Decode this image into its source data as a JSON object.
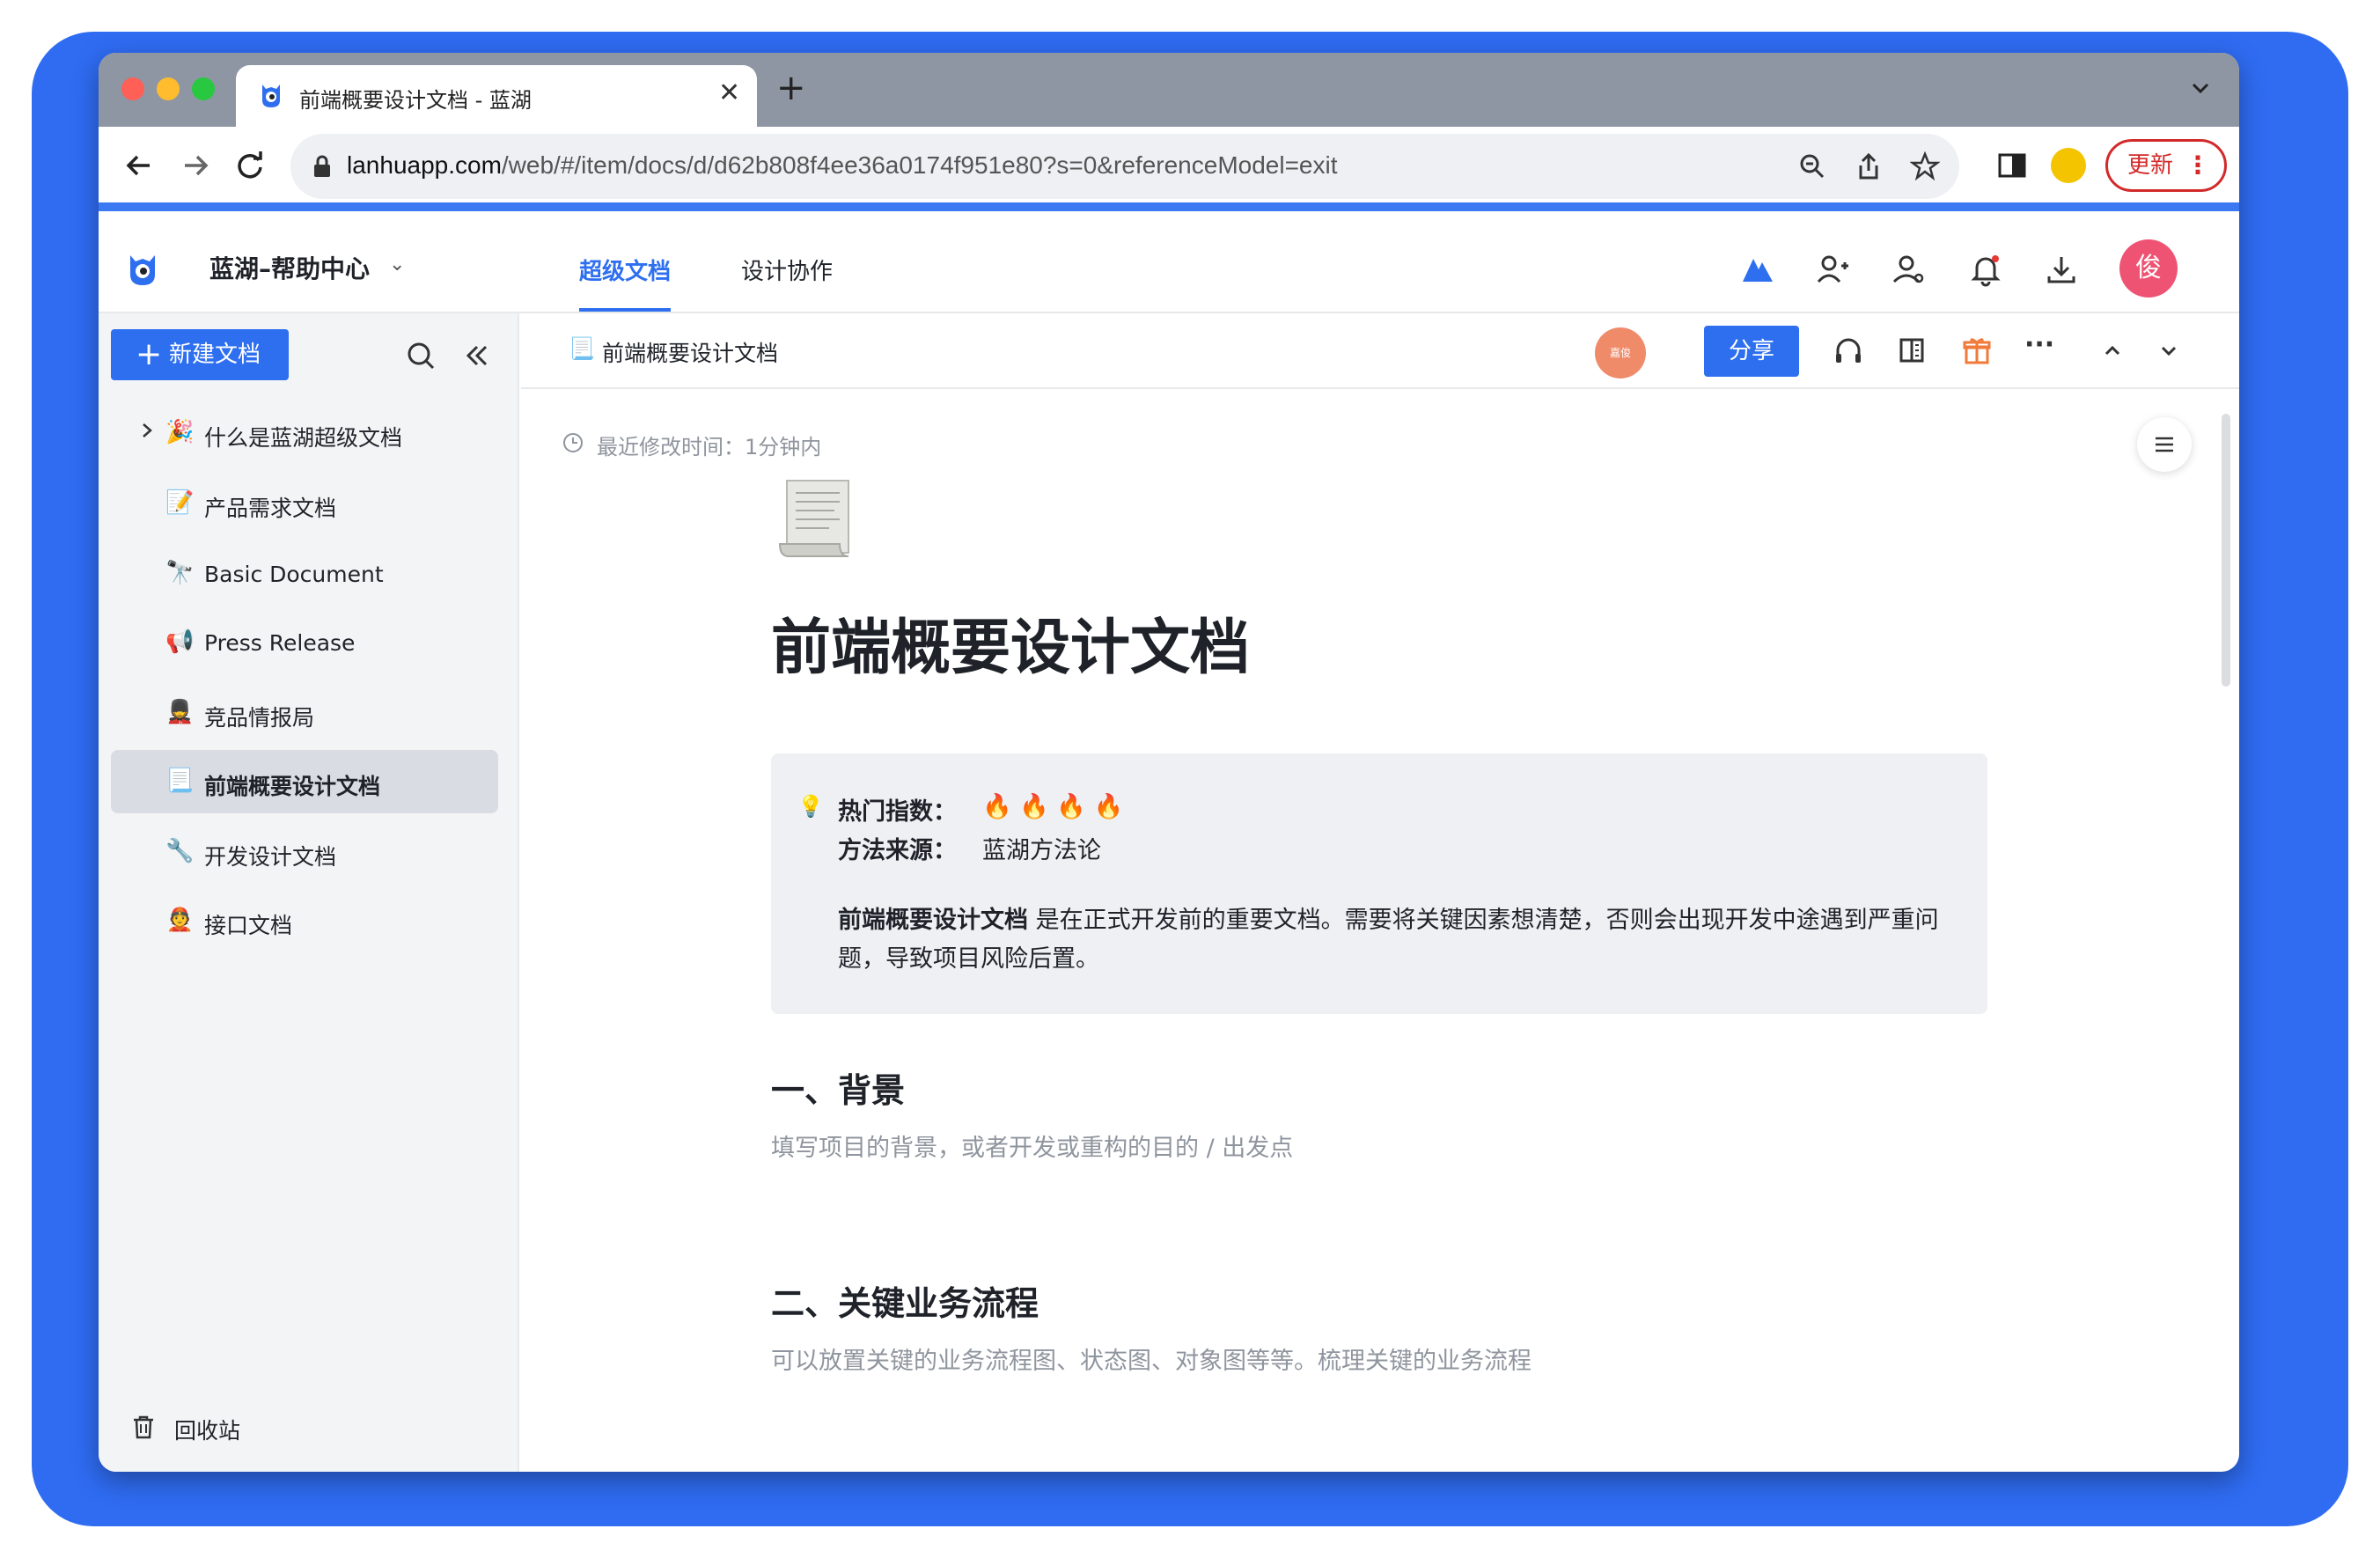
{
  "browser": {
    "tab_title": "前端概要设计文档 - 蓝湖",
    "tab_close": "✕",
    "new_tab": "+",
    "url_host": "lanhuapp.com",
    "url_path": "/web/#/item/docs/d/d62b808f4ee36a0174f951e80?s=0&referenceModel=exit",
    "update_label": "更新",
    "update_menu": "⋮"
  },
  "header": {
    "workspace_title": "蓝湖–帮助中心",
    "caret": "⌄",
    "tabs": [
      {
        "label": "超级文档"
      },
      {
        "label": "设计协作"
      }
    ],
    "user_avatar": "俊"
  },
  "sidebar": {
    "new_doc_label": "新建文档",
    "new_doc_plus": "+",
    "items": [
      {
        "emoji": "🎉",
        "label": "什么是蓝湖超级文档"
      },
      {
        "emoji": "📝",
        "label": "产品需求文档"
      },
      {
        "emoji": "🔭",
        "label": "Basic Document"
      },
      {
        "emoji": "📢",
        "label": "Press Release"
      },
      {
        "emoji": "💂",
        "label": "竞品情报局"
      },
      {
        "emoji": "📃",
        "label": "前端概要设计文档"
      },
      {
        "emoji": "🔧",
        "label": "开发设计文档"
      },
      {
        "emoji": "👲",
        "label": "接口文档"
      }
    ],
    "trash_label": "回收站"
  },
  "docbar": {
    "emoji": "📃",
    "title": "前端概要设计文档",
    "collaborator_avatar": "嘉俊",
    "share_label": "分享",
    "more": "···"
  },
  "document": {
    "last_modified": "最近修改时间：1分钟内",
    "icon": "scroll-icon",
    "title": "前端概要设计文档",
    "callout": {
      "bulb": "💡",
      "hot_key": "热门指数：",
      "hot_value": "🔥 🔥 🔥 🔥",
      "source_key": "方法来源：",
      "source_value": "蓝湖方法论",
      "para_bold": "前端概要设计文档",
      "para_rest": " 是在正式开发前的重要文档。需要将关键因素想清楚，否则会出现开发中途遇到严重问题，导致项目风险后置。"
    },
    "sections": [
      {
        "heading": "一、背景",
        "text": "填写项目的背景，或者开发或重构的目的 / 出发点"
      },
      {
        "heading": "二、关键业务流程",
        "text": "可以放置关键的业务流程图、状态图、对象图等等。梳理关键的业务流程"
      }
    ]
  },
  "colors": {
    "accent": "#2e6ff0",
    "frame_blue": "#2f6cf2",
    "update_red": "#d22a2a",
    "avatar_pink": "#ee5373"
  }
}
